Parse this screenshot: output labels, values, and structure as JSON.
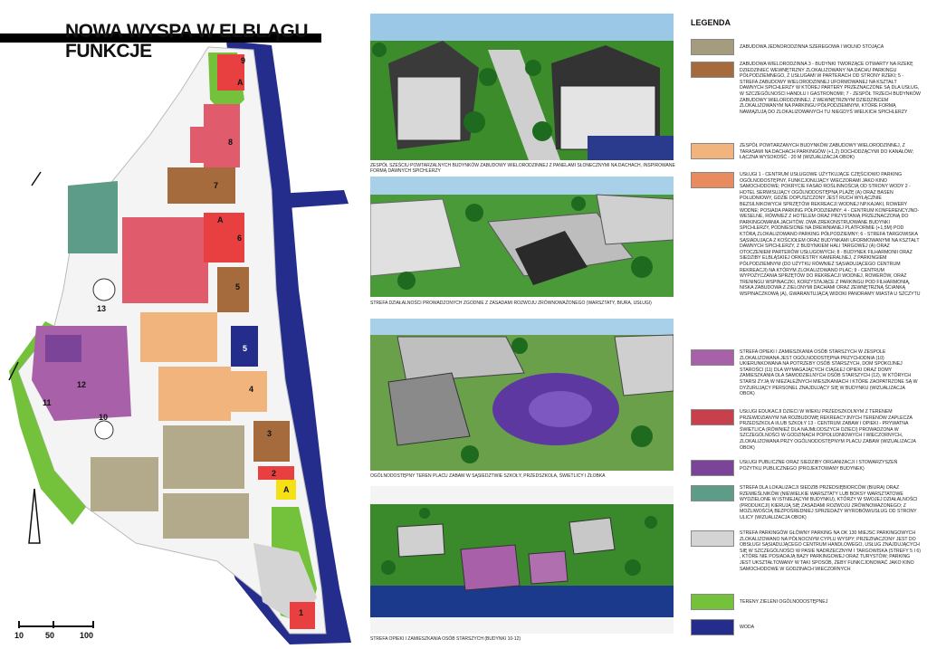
{
  "title": {
    "line1": "NOWA WYSPA W ELBLĄGU",
    "line2": "FUNKCJE"
  },
  "map": {
    "zone_labels": [
      "9",
      "A",
      "8",
      "7",
      "A",
      "6",
      "5",
      "13",
      "5",
      "4",
      "12",
      "11",
      "10",
      "3",
      "2",
      "A",
      "1"
    ],
    "scale": {
      "ticks": [
        "10",
        "50",
        "100"
      ]
    }
  },
  "renders": [
    {
      "caption": "ZESPÓŁ SZEŚCIU POWTARZALNYCH BUDYNKÓW ZABUDOWY WIELORODZINNEJ Z PANELAMI SŁONECZNYMI NA DACHACH, INSPIROWANE FORMĄ DAWNYCH SPICHLERZY"
    },
    {
      "caption": "STREFA DZIAŁALNOŚCI PROWADZONYCH ZGODNIE Z ZASADAMI ROZWOJU ZRÓWNOWAŻONEGO (WARSZTATY, BIURA, USŁUGI)"
    },
    {
      "caption": "OGÓLNODOSTĘPNY TEREN PLACU ZABAW W SĄSIEDZTWIE SZKOŁY, PRZEDSZKOLA, ŚWIETLICY I ŻŁOBKA"
    },
    {
      "caption": "STREFA OPIEKI I ZAMIESZKANIA OSÓB STARSZYCH (budynki 10-12)"
    }
  ],
  "legend": {
    "title": "LEGENDA",
    "items": [
      {
        "color": "#a59c80",
        "text": "ZABUDOWA JEDNORODZINNA SZEREGOWA I WOLNO STOJĄCA"
      },
      {
        "color": "#a56b3c",
        "text": "ZABUDOWA WIELORODZINNA 3 - BUDYNKI TWORZĄCE OTWARTY NA RZEKĘ DZIEDZINIEC WEWNĘTRZNY ZLOKALIZOWANY NA DACHU PARKINGU PÓŁPODZIEMNEGO, Z USŁUGAMI W PARTERACH OD STRONY RZEKI; 5 - STREFA ZABUDOWY WIELORODZINNEJ UFORMOWANEJ NA KSZTAŁT DAWNYCH SPICHLERZY W KTÓREJ PARTERY PRZEZNACZONE SĄ DLA USŁUG, W SZCZEGÓLNOŚCI HANDLU I GASTRONOMII; 7 - ZESPÓŁ TRZECH BUDYNKÓW ZABUDOWY WIELORODZINNEJ, Z WEWNĘTRZNYM DZIEDZIŃCEM ZLOKALIZOWANYM NA PARKINGU PÓŁPODZIEMNYM, KTÓRE FORMĄ NAWIĄZUJĄ DO ZLOKALIZOWANYCH TU NIEGDYŚ WIELKICH SPICHLERZY"
      },
      {
        "color": "#f0b47c",
        "text": "ZESPÓŁ POWTARZANYCH BUDYNKÓW ZABUDOWY WIELORODZINNEJ, Z TARASAMI NA DACHACH PARKINGÓW (+1,2) DOCHODZĄCYMI DO KANAŁÓW; ŁĄCZNA WYSOKOŚĆ - 20 m (wizualizacja obok)"
      },
      {
        "color": "#e88c60",
        "text": "USŁUGI 1 - CENTRUM USŁUGOWE UŻYTKUJĄCE CZĘŚCIOWO PARKING OGÓLNODOSTĘPNY, FUNKCJONUJĄCY WIECZORAMI JAKO KINO SAMOCHODOWE; POKRYCIE FASAD ROŚLINNOŚCIĄ OD STRONY WODY 2 - HOTEL SERWISUJĄCY OGÓLNODOSTĘPNĄ PLAŻĘ (A) ORAZ BASEN POŁUDNIOWY, GDZIE DOPUSZCZONY JEST RUCH WYŁĄCZNIE BEZSILNIKOWYCH SPRZĘTÓW REKREACJI WODNEJ NP.KAJAKI, ROWERY WODNE; POSIADA PARKING PÓŁPODZIEMNY; 4 - CENTRUM KONFERENCYJNO-WESELNE, RÓWNIEŻ Z HOTELEM ORAZ PRZYSTANIĄ PRZEZNACZONĄ DO PARKINGOWANIA JACHTÓW. DWA ZREKONSTRUOWANE BUDYNKI SPICHLERZY, PODNIESIONE NA DREWNIANEJ PLATFORMIE (+1,5m) POD KTÓRĄ ZLOKALIZOWANO PARKING PÓŁPODZIEMNY; 6 - STREFA TARGOWISKA SĄSIADUJĄCA Z KOŚCIOŁEM ORAZ BUDYNKAMI UFORMOWANYMI NA KSZTAŁT DAWNYCH SPICHLERZY, Z BUDYNKIEM HALI TARGOWEJ (A) ORAZ OTOCZENIEM PARTERÓW USŁUGOWYCH; 8 - BUDYNEK FILHARMONII ORAZ SIEDZIBY ELBLĄSKIEJ ORKIESTRY KAMERALNEJ, Z PARKINGIEM PÓŁPODZIEMNYM (DO UŻYTKU RÓWNIEŻ SĄSIADUJĄCEGO CENTRUM REKREACJI) NA KTÓRYM ZLOKALIZOWANO PLAC; 9 - CENTRUM WYPOŻYCZANIA SPRZĘTÓW DO REKREACJI WODNEJ, ROWERÓW, ORAZ TRENINGU WSPINACZKI, KORZYSTAJĄCE Z PARKINGU POD FILHARMONIĄ, NISKA ZABUDOWA Z ZIELONYMI DACHAMI ORAZ ZEWNĘTRZNĄ ŚCIANKĄ WSPINACZKOWĄ (A), GWARANTUJĄCĄ WIDOKI PANORAMY MIASTA U SZCZYTU"
      },
      {
        "color": "#a860a8",
        "text": "STREFA OPIEKI I ZAMIESZKANIA OSÓB STARSZYCH W ZESPOLE ZLOKALIZOWANA JEST OGÓLNODOSTĘPNA PRZYCHODNIA (10) UKIERUNKOWANA NA POTRZEBY OSÓB STARSZYCH, DOM SPOKOJNEJ STAROŚCI (11) DLA WYMAGAJĄCYCH CIĄGŁEJ OPIEKI ORAZ DOMY ZAMIESZKANIA DLA SAMODZIELNYCH OSÓB STARSZYCH (12), W KTÓRYCH STARSI ŻYJĄ W NIEZALEŻNYCH MIESZKANIACH I KTÓRE ZAOPATRZONE SĄ W DYŻURUJĄCY PERSONEL ZNAJDUJĄCY SIĘ W BUDYNKU (wizualizacja obok)"
      },
      {
        "color": "#c8404c",
        "text": "USŁUGI EDUKACJI DZIECI W WIEKU PRZEDSZKOLNYM Z TERENEM PRZEWIDZIANYM NA ROZBUDOWĘ REKREACYJNYCH TERENÓW ZAPLECZA PRZEDSZKOLA I/LUB SZKOŁY 13 - CENTRUM ZABAW I OPIEKI - PRYWATNA ŚWIETLICA (RÓWNIEŻ DLA NAJMŁODSZYCH DZIECI) PROWADZONA W SZCZEGÓLNOŚCI W GODZINACH POPOŁUDNIOWYCH I WIECZORNYCH, ZLOKALIZOWANA PRZY OGÓLNODOSTĘPNYM PLACU ZABAW (wizualizacja obok)"
      },
      {
        "color": "#7c4498",
        "text": "USŁUGI PUBLICZNE ORAZ SIEDZIBY ORGANIZACJI I STOWARZYSZEŃ POŻYTKU PUBLICZNEGO (PROJEKTOWANY BUDYNEK)"
      },
      {
        "color": "#5c9c88",
        "text": "STREFA DLA LOKALIZACJI SIEDZIB PRZEDSIĘBIORCÓW (BIURA) ORAZ RZEMIEŚLNIKÓW (NIEWIELKIE WARSZTATY LUB BOKSY WARSZTATOWE WYDZIELONE W ISTNIEJĄCYM BUDYNKU), KTÓRZY W SWOJEJ DZIAŁALNOŚCI (PRODUKCJI) KIERUJĄ SIĘ ZASADAMI ROZWOJU ZRÓWNOWAŻONEGO; Z MOŻLIWOŚCIĄ BEZPOŚREDNIEJ SPRZEDAŻY WYROBÓW/USŁUG OD STRONY ULICY (wizualizacja obok)"
      },
      {
        "color": "#d4d4d4",
        "text": "STREFA PARKINGÓW GŁÓWNY PARKING NA OK 130 MIEJSC PARKINGOWYCH ZLOKALIZOWANO NA PÓŁNOCNYM CYPLU WYSPY; PRZEZNACZONY JEST DO OBSŁUGI SĄSIADUJĄCEGO CENTRUM HANDLOWEGO, USŁUG ZNAJDUJĄCYCH SIĘ W SZCZEGÓLNOŚCI W PASIE NADRZECZNYM I TARGOWISKA (STREFY 5 i 6) , KTÓRE NIE POSIADAJĄ BAZY PARKINGOWEJ ORAZ TURYSTÓW; PARKING JEST UKSZTAŁTOWANY W TAKI SPOSÓB, ŻEBY FUNKCJONOWAĆ JAKO KINO SAMOCHODOWE W GODZINACH WIECZORNYCH"
      },
      {
        "color": "#74c23c",
        "text": "TERENY ZIELENI OGÓLNODOSTĘPNEJ"
      },
      {
        "color": "#242c8c",
        "text": "WODA"
      }
    ]
  },
  "colors": {
    "water": "#242c8c",
    "green": "#74c23c",
    "residential_single": "#b3aa8c",
    "residential_multi": "#a56b3c",
    "residential_light": "#f0b47c",
    "services": "#e05c6c",
    "services_red": "#e84040",
    "elderly": "#a860a8",
    "business": "#5c9c88",
    "parking": "#d4d4d4",
    "yellow": "#f4e014"
  }
}
